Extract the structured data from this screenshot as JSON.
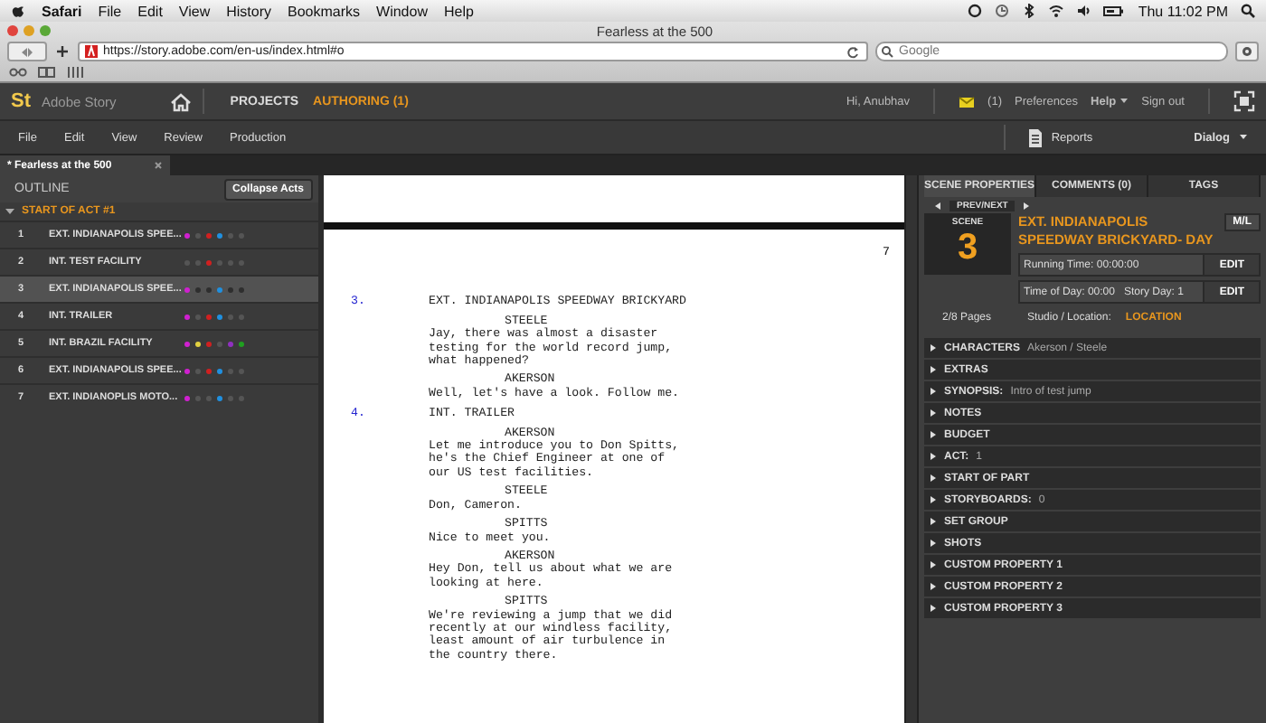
{
  "menubar": {
    "items": [
      "Safari",
      "File",
      "Edit",
      "View",
      "History",
      "Bookmarks",
      "Window",
      "Help"
    ],
    "clock": "Thu 11:02 PM"
  },
  "browser": {
    "title": "Fearless at the 500",
    "url": "https://story.adobe.com/en-us/index.html#o",
    "search_placeholder": "Google"
  },
  "app_header": {
    "logo": "St",
    "product": "Adobe Story",
    "nav": [
      {
        "label": "PROJECTS",
        "selected": false
      },
      {
        "label": "AUTHORING (1)",
        "selected": true
      }
    ],
    "greeting": "Hi, Anubhav",
    "messages": "(1)",
    "preferences": "Preferences",
    "help": "Help",
    "sign_out": "Sign out"
  },
  "menu": [
    "File",
    "Edit",
    "View",
    "Review",
    "Production"
  ],
  "reports": "Reports",
  "view_mode": "Dialog",
  "doc_tab": "* Fearless at the 500",
  "outline": {
    "title": "OUTLINE",
    "collapse": "Collapse Acts",
    "act": "START OF ACT #1",
    "scenes": [
      {
        "number": "1",
        "label": "EXT. INDIANAPOLIS SPEE...",
        "selected": false,
        "tags": [
          {
            "color": "#d020d0"
          },
          {
            "color": "#555555"
          },
          {
            "color": "#d02020"
          },
          {
            "color": "#2090e0"
          },
          {
            "color": "#555555"
          },
          {
            "color": "#555555"
          }
        ]
      },
      {
        "number": "2",
        "label": "INT. TEST FACILITY",
        "selected": false,
        "tags": [
          {
            "color": "#555555"
          },
          {
            "color": "#555555"
          },
          {
            "color": "#d02020"
          },
          {
            "color": "#555555"
          },
          {
            "color": "#555555"
          },
          {
            "color": "#555555"
          }
        ]
      },
      {
        "number": "3",
        "label": "EXT. INDIANAPOLIS SPEE...",
        "selected": true,
        "tags": [
          {
            "color": "#d020d0"
          },
          {
            "color": "#2e2e2e"
          },
          {
            "color": "#2e2e2e"
          },
          {
            "color": "#2090e0"
          },
          {
            "color": "#2e2e2e"
          },
          {
            "color": "#2e2e2e"
          }
        ]
      },
      {
        "number": "4",
        "label": "INT. TRAILER",
        "selected": false,
        "tags": [
          {
            "color": "#d020d0"
          },
          {
            "color": "#555555"
          },
          {
            "color": "#d02020"
          },
          {
            "color": "#2090e0"
          },
          {
            "color": "#555555"
          },
          {
            "color": "#555555"
          }
        ]
      },
      {
        "number": "5",
        "label": "INT. BRAZIL FACILITY",
        "selected": false,
        "tags": [
          {
            "color": "#d020d0"
          },
          {
            "color": "#e0d040"
          },
          {
            "color": "#d02020"
          },
          {
            "color": "#555555"
          },
          {
            "color": "#9030c0"
          },
          {
            "color": "#20a020"
          }
        ]
      },
      {
        "number": "6",
        "label": "EXT. INDIANAPOLIS SPEE...",
        "selected": false,
        "tags": [
          {
            "color": "#d020d0"
          },
          {
            "color": "#555555"
          },
          {
            "color": "#d02020"
          },
          {
            "color": "#2090e0"
          },
          {
            "color": "#555555"
          },
          {
            "color": "#555555"
          }
        ]
      },
      {
        "number": "7",
        "label": "EXT. INDIANOPLIS MOTO...",
        "selected": false,
        "tags": [
          {
            "color": "#d020d0"
          },
          {
            "color": "#555555"
          },
          {
            "color": "#555555"
          },
          {
            "color": "#2090e0"
          },
          {
            "color": "#555555"
          },
          {
            "color": "#555555"
          }
        ]
      }
    ]
  },
  "script": {
    "page_number": "7",
    "lines": [
      {
        "kind": "heading",
        "number": "3.",
        "text": "EXT. INDIANAPOLIS SPEEDWAY BRICKYARD"
      },
      {
        "kind": "character",
        "text": "STEELE"
      },
      {
        "kind": "dialogue",
        "text": "Jay, there was almost a disaster\ntesting for the world record jump,\nwhat happened?"
      },
      {
        "kind": "character",
        "text": "AKERSON"
      },
      {
        "kind": "dialogue",
        "text": "Well, let's have a look. Follow me."
      },
      {
        "kind": "heading",
        "number": "4.",
        "text": "INT. TRAILER"
      },
      {
        "kind": "character",
        "text": "AKERSON"
      },
      {
        "kind": "dialogue",
        "text": "Let me introduce you to Don Spitts,\nhe's the Chief Engineer at one of\nour US test facilities."
      },
      {
        "kind": "character",
        "text": "STEELE"
      },
      {
        "kind": "dialogue",
        "text": "Don, Cameron."
      },
      {
        "kind": "character",
        "text": "SPITTS"
      },
      {
        "kind": "dialogue",
        "text": "Nice to meet you."
      },
      {
        "kind": "character",
        "text": "AKERSON"
      },
      {
        "kind": "dialogue",
        "text": "Hey Don, tell us about what we are\nlooking at here."
      },
      {
        "kind": "character",
        "text": "SPITTS"
      },
      {
        "kind": "dialogue",
        "text": "We're reviewing a jump that we did\nrecently at our windless facility,\nleast amount of air turbulence in\nthe country there."
      }
    ]
  },
  "properties": {
    "tabs": [
      {
        "label": "SCENE PROPERTIES",
        "selected": true
      },
      {
        "label": "COMMENTS (0)",
        "selected": false
      },
      {
        "label": "TAGS",
        "selected": false
      }
    ],
    "prev_next": "PREV/NEXT",
    "scene_label": "SCENE",
    "scene_number": "3",
    "title": "EXT. INDIANAPOLIS SPEEDWAY BRICKYARD- DAY",
    "ml": "M/L",
    "running_time": "Running Time: 00:00:00",
    "time_of_day": "Time of Day: 00:00",
    "story_day": "Story Day: 1",
    "edit_1": "EDIT",
    "edit_2": "EDIT",
    "pages": "2/8 Pages",
    "location_label": "Studio / Location:",
    "location_value": "LOCATION",
    "sections": [
      {
        "label": "CHARACTERS",
        "value": "Akerson / Steele"
      },
      {
        "label": "EXTRAS"
      },
      {
        "label": "SYNOPSIS:",
        "value": "Intro of test jump"
      },
      {
        "label": "NOTES"
      },
      {
        "label": "BUDGET"
      },
      {
        "label": "ACT:",
        "value": "1"
      },
      {
        "label": "START OF PART"
      },
      {
        "label": "STORYBOARDS:",
        "value": "0"
      },
      {
        "label": "SET GROUP"
      },
      {
        "label": "SHOTS"
      },
      {
        "label": "CUSTOM PROPERTY 1"
      },
      {
        "label": "CUSTOM PROPERTY 2"
      },
      {
        "label": "CUSTOM PROPERTY 3"
      }
    ]
  }
}
